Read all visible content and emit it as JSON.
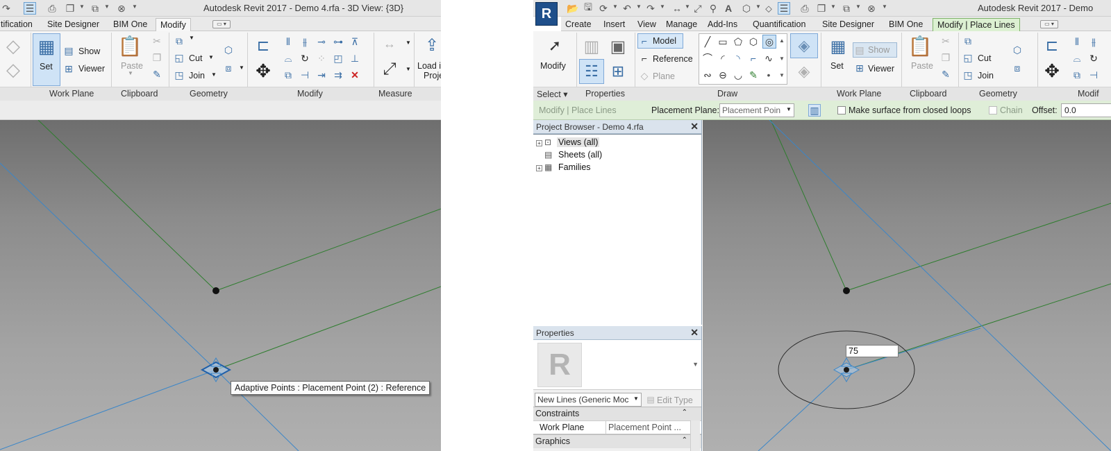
{
  "left": {
    "title": "Autodesk Revit 2017 -    Demo 4.rfa - 3D View: {3D}",
    "tabs": [
      "tification",
      "Site Designer",
      "BIM One",
      "Modify"
    ],
    "active_tab": "Modify",
    "ribbon": {
      "set": "Set",
      "show": "Show",
      "viewer": "Viewer",
      "paste": "Paste",
      "cut": "Cut",
      "join": "Join",
      "load": "Load i",
      "load2": "Proje"
    },
    "panels": [
      "Work Plane",
      "Clipboard",
      "Geometry",
      "Modify",
      "Measure"
    ],
    "tooltip": "Adaptive Points : Placement Point (2) : Reference"
  },
  "right": {
    "title": "Autodesk Revit 2017 -    Demo",
    "tabs": [
      "Create",
      "Insert",
      "View",
      "Manage",
      "Add-Ins",
      "Quantification",
      "Site Designer",
      "BIM One",
      "Modify | Place Lines"
    ],
    "active_tab": "Modify | Place Lines",
    "ribbon": {
      "modify": "Modify",
      "model": "Model",
      "reference": "Reference",
      "plane": "Plane",
      "show": "Show",
      "set": "Set",
      "viewer": "Viewer",
      "paste": "Paste",
      "cut": "Cut",
      "join": "Join"
    },
    "panels": [
      "Select ▾",
      "Properties",
      "Draw",
      "Work Plane",
      "Clipboard",
      "Geometry",
      "Modif"
    ],
    "options_bar": {
      "context": "Modify | Place Lines",
      "placement_plane_label": "Placement Plane:",
      "placement_plane_value": "Placement Poin",
      "make_surface": "Make surface from closed loops",
      "chain": "Chain",
      "offset_label": "Offset:",
      "offset_value": "0.0"
    },
    "project_browser": {
      "title": "Project Browser - Demo 4.rfa",
      "items": [
        "Views (all)",
        "Sheets (all)",
        "Families"
      ]
    },
    "properties": {
      "title": "Properties",
      "type_selector": "New Lines (Generic Moc",
      "edit_type": "Edit Type",
      "group": "Constraints",
      "rows": [
        {
          "name": "Work Plane",
          "value": "Placement Point ..."
        }
      ],
      "next_group": "Graphics"
    },
    "dimension_value": "75"
  },
  "colors": {
    "ribbon_accent": "#cfe3f6",
    "context_tab": "#dcf0d2",
    "model_line": "#2e7d2e",
    "reference_line": "#3b86c8"
  }
}
